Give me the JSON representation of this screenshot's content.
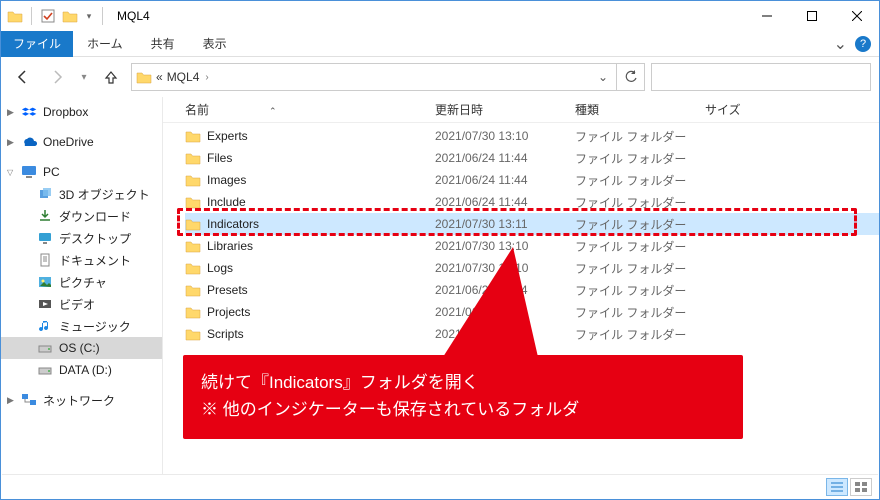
{
  "window": {
    "title": "MQL4"
  },
  "ribbon": {
    "file": "ファイル",
    "home": "ホーム",
    "share": "共有",
    "view": "表示"
  },
  "address": {
    "crumbs": [
      "MQL4"
    ],
    "prefix": "«"
  },
  "columns": {
    "name": "名前",
    "date": "更新日時",
    "type": "種類",
    "size": "サイズ"
  },
  "nav": {
    "dropbox": "Dropbox",
    "onedrive": "OneDrive",
    "pc": "PC",
    "objects3d": "3D オブジェクト",
    "downloads": "ダウンロード",
    "desktop": "デスクトップ",
    "documents": "ドキュメント",
    "pictures": "ピクチャ",
    "videos": "ビデオ",
    "music": "ミュージック",
    "osc": "OS (C:)",
    "datad": "DATA (D:)",
    "network": "ネットワーク"
  },
  "files": [
    {
      "name": "Experts",
      "date": "2021/07/30 13:10",
      "type": "ファイル フォルダー",
      "selected": false
    },
    {
      "name": "Files",
      "date": "2021/06/24 11:44",
      "type": "ファイル フォルダー",
      "selected": false
    },
    {
      "name": "Images",
      "date": "2021/06/24 11:44",
      "type": "ファイル フォルダー",
      "selected": false
    },
    {
      "name": "Include",
      "date": "2021/06/24 11:44",
      "type": "ファイル フォルダー",
      "selected": false
    },
    {
      "name": "Indicators",
      "date": "2021/07/30 13:11",
      "type": "ファイル フォルダー",
      "selected": true
    },
    {
      "name": "Libraries",
      "date": "2021/07/30 13:10",
      "type": "ファイル フォルダー",
      "selected": false
    },
    {
      "name": "Logs",
      "date": "2021/07/30 13:10",
      "type": "ファイル フォルダー",
      "selected": false
    },
    {
      "name": "Presets",
      "date": "2021/06/24 11:44",
      "type": "ファイル フォルダー",
      "selected": false
    },
    {
      "name": "Projects",
      "date": "2021/06/24 11:44",
      "type": "ファイル フォルダー",
      "selected": false
    },
    {
      "name": "Scripts",
      "date": "2021/07/30 13:10",
      "type": "ファイル フォルダー",
      "selected": false
    }
  ],
  "callout": {
    "line1": "続けて『Indicators』フォルダを開く",
    "line2": "※ 他のインジケーターも保存されているフォルダ"
  }
}
